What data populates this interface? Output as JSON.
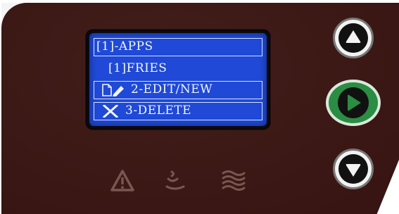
{
  "display": {
    "rows": [
      {
        "text": "[1]-APPS"
      },
      {
        "text": "[1]FRIES"
      },
      {
        "text": "2-EDIT/NEW",
        "icon": "edit-icon"
      },
      {
        "text": "3-DELETE",
        "icon": "x-icon"
      }
    ],
    "background_color": "#1f49d6",
    "text_color": "#f1f5ff"
  },
  "controls": {
    "up": {
      "icon": "up-arrow-icon"
    },
    "select": {
      "icon": "play-arrow-icon",
      "color": "#2b8c44"
    },
    "down": {
      "icon": "down-arrow-icon"
    }
  },
  "indicators": [
    {
      "icon": "warning-icon"
    },
    {
      "icon": "heat-icon"
    },
    {
      "icon": "steam-icon"
    }
  ],
  "panel_color": "#3b1512"
}
